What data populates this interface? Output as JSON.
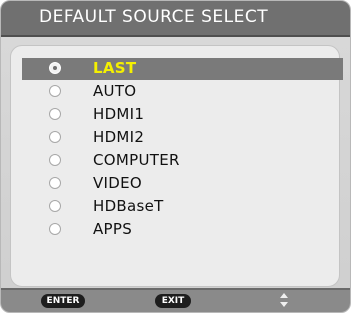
{
  "window": {
    "title": "DEFAULT SOURCE SELECT"
  },
  "sources": [
    {
      "label": "LAST",
      "selected": true
    },
    {
      "label": "AUTO",
      "selected": false
    },
    {
      "label": "HDMI1",
      "selected": false
    },
    {
      "label": "HDMI2",
      "selected": false
    },
    {
      "label": "COMPUTER",
      "selected": false
    },
    {
      "label": "VIDEO",
      "selected": false
    },
    {
      "label": "HDBaseT",
      "selected": false
    },
    {
      "label": "APPS",
      "selected": false
    }
  ],
  "footer": {
    "enter_label": "ENTER",
    "exit_label": "EXIT",
    "updown_icon": "up-down-arrows-icon"
  },
  "colors": {
    "selected_text": "#f5f000",
    "selected_bar": "#7a7a7a",
    "title_bar": "#707070"
  }
}
